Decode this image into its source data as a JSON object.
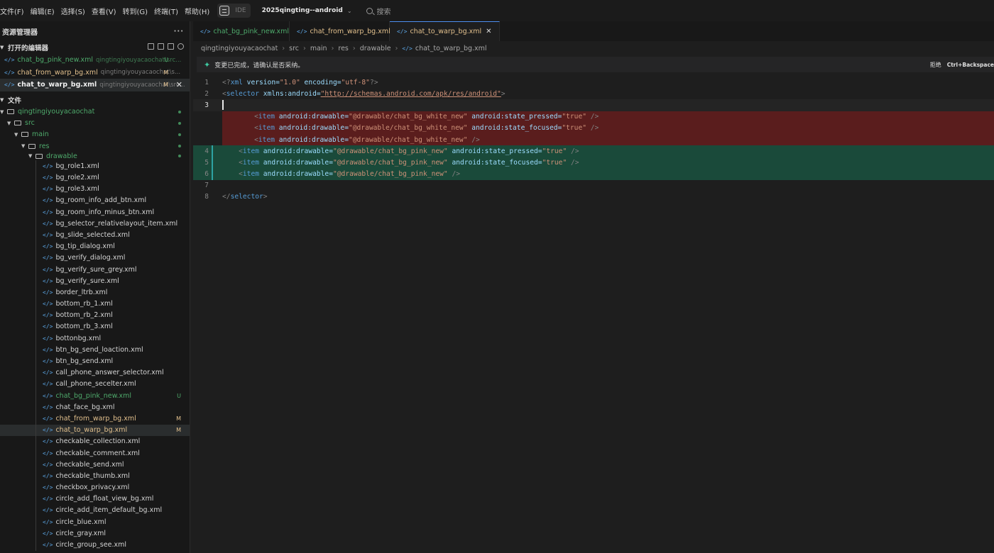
{
  "menubar": {
    "items": [
      "文件(F)",
      "编辑(E)",
      "选择(S)",
      "查看(V)",
      "转到(G)",
      "终端(T)",
      "帮助(H)"
    ],
    "ide_label": "IDE",
    "project": "2025qingting--android",
    "search_label": "搜索"
  },
  "sidebar": {
    "title": "资源管理器",
    "open_editors_title": "打开的编辑器",
    "open_editors": [
      {
        "name": "chat_bg_pink_new.xml",
        "path": "qingtingiyouyacaochat\\src...",
        "badge": "U"
      },
      {
        "name": "chat_from_warp_bg.xml",
        "path": "qingtingiyouyacaochat\\s...",
        "badge": "M"
      },
      {
        "name": "chat_to_warp_bg.xml",
        "path": "qingtingiyouyacaochat\\src...",
        "badge": "M"
      }
    ],
    "files_title": "文件",
    "folders": [
      "qingtingiyouyacaochat",
      "src",
      "main",
      "res",
      "drawable"
    ],
    "files": [
      "bg_role1.xml",
      "bg_role2.xml",
      "bg_role3.xml",
      "bg_room_info_add_btn.xml",
      "bg_room_info_minus_btn.xml",
      "bg_selector_relativelayout_item.xml",
      "bg_slide_selected.xml",
      "bg_tip_dialog.xml",
      "bg_verify_dialog.xml",
      "bg_verify_sure_grey.xml",
      "bg_verify_sure.xml",
      "border_ltrb.xml",
      "bottom_rb_1.xml",
      "bottom_rb_2.xml",
      "bottom_rb_3.xml",
      "bottonbg.xml",
      "btn_bg_send_loaction.xml",
      "btn_bg_send.xml",
      "call_phone_answer_selector.xml",
      "call_phone_secelter.xml",
      "chat_bg_pink_new.xml",
      "chat_face_bg.xml",
      "chat_from_warp_bg.xml",
      "chat_to_warp_bg.xml",
      "checkable_collection.xml",
      "checkable_comment.xml",
      "checkable_send.xml",
      "checkable_thumb.xml",
      "checkbox_privacy.xml",
      "circle_add_float_view_bg.xml",
      "circle_add_item_default_bg.xml",
      "circle_blue.xml",
      "circle_gray.xml",
      "circle_group_see.xml"
    ],
    "badges": {
      "U": "U",
      "M": "M"
    }
  },
  "editor": {
    "tabs": [
      "chat_bg_pink_new.xml",
      "chat_from_warp_bg.xml",
      "chat_to_warp_bg.xml"
    ],
    "breadcrumb": [
      "qingtingiyouyacaochat",
      "src",
      "main",
      "res",
      "drawable",
      "chat_to_warp_bg.xml"
    ],
    "notice": "变更已完成，请确认是否采纳。",
    "notice_reject": "拒绝",
    "notice_shortcut": "Ctrl+Backspace",
    "line_numbers": {
      "l1": "1",
      "l2": "2",
      "l3": "3",
      "l4": "4",
      "l5": "5",
      "l6": "6",
      "l7": "7",
      "l8": "8"
    },
    "code": {
      "xml_decl_open": "<?",
      "xml_decl_name": "xml",
      "version_attr": " version=",
      "version_val": "\"1.0\"",
      "encoding_attr": " encoding=",
      "encoding_val": "\"utf-8\"",
      "xml_decl_close": "?>",
      "selector_open": "<",
      "selector_tag": "selector",
      "xmlns_attr": " xmlns:android=",
      "xmlns_url": "\"http://schemas.android.com/apk/res/android\"",
      "selector_end": ">",
      "indent": "    ",
      "item_open": "<",
      "item_tag": "item",
      "drawable_attr": " android:drawable=",
      "white_val": "\"@drawable/chat_bg_white_new\"",
      "pink_val": "\"@drawable/chat_bg_pink_new\"",
      "pressed_attr": " android:state_pressed=",
      "focused_attr": " android:state_focused=",
      "true_val": "\"true\"",
      "self_close": " />",
      "selector_close_open": "</",
      "selector_close_end": ">"
    }
  },
  "colors": {
    "accent": "#4d8ff0",
    "added": "#1a4a3a",
    "deleted": "#5a1d1d",
    "untracked": "#4ea96b",
    "modified": "#e2c08d"
  }
}
